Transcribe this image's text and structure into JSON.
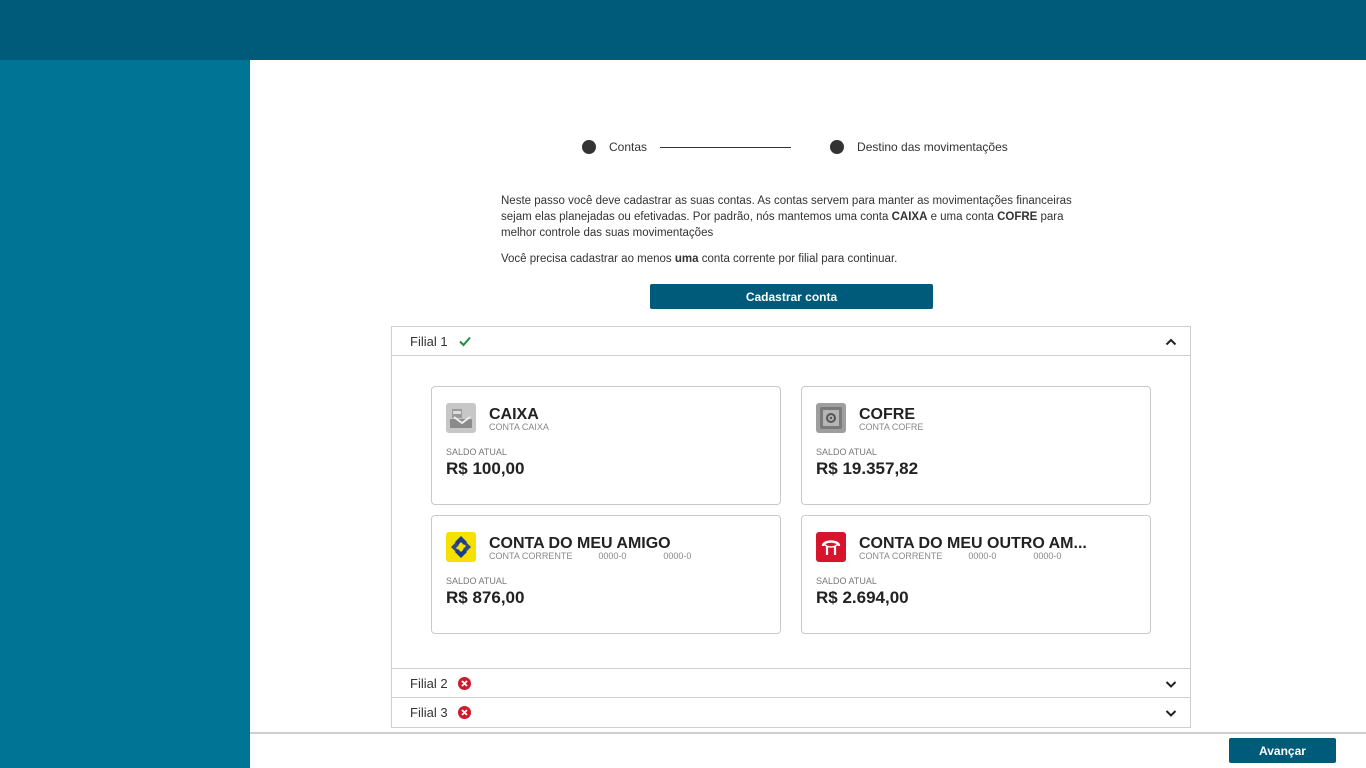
{
  "stepper": {
    "steps": [
      {
        "label": "Contas"
      },
      {
        "label": "Destino das movimentações"
      }
    ]
  },
  "description": {
    "p1_a": "Neste passo você deve cadastrar as suas contas. As contas servem para manter as movimentações financeiras sejam elas planejadas ou efetivadas. Por padrão, nós mantemos uma conta ",
    "p1_b": "CAIXA",
    "p1_c": " e uma conta ",
    "p1_d": "COFRE",
    "p1_e": " para melhor controle das suas movimentações",
    "p2_a": "Você precisa cadastrar ao menos ",
    "p2_b": "uma",
    "p2_c": " conta corrente por filial para continuar."
  },
  "actions": {
    "register_label": "Cadastrar conta",
    "next_label": "Avançar"
  },
  "branches": [
    {
      "title": "Filial 1",
      "status": "ok",
      "expanded": true,
      "accounts": [
        {
          "name": "CAIXA",
          "type": "CONTA CAIXA",
          "agency": "",
          "number": "",
          "balance_label": "SALDO ATUAL",
          "balance": "R$ 100,00",
          "icon": "cash-register-icon"
        },
        {
          "name": "COFRE",
          "type": "CONTA COFRE",
          "agency": "",
          "number": "",
          "balance_label": "SALDO ATUAL",
          "balance": "R$ 19.357,82",
          "icon": "safe-icon"
        },
        {
          "name": "CONTA DO MEU AMIGO",
          "type": "CONTA CORRENTE",
          "agency": "0000-0",
          "number": "0000-0",
          "balance_label": "SALDO ATUAL",
          "balance": "R$ 876,00",
          "icon": "banco-do-brasil-logo-icon"
        },
        {
          "name": "CONTA DO MEU OUTRO AM...",
          "type": "CONTA CORRENTE",
          "agency": "0000-0",
          "number": "0000-0",
          "balance_label": "SALDO ATUAL",
          "balance": "R$ 2.694,00",
          "icon": "bradesco-logo-icon"
        }
      ]
    },
    {
      "title": "Filial 2",
      "status": "error",
      "expanded": false
    },
    {
      "title": "Filial 3",
      "status": "error",
      "expanded": false
    }
  ],
  "colors": {
    "topbar": "#005a7a",
    "sidebar": "#007494",
    "primary_button": "#005a7a",
    "ok": "#1e8f3a",
    "error": "#d0192b"
  }
}
